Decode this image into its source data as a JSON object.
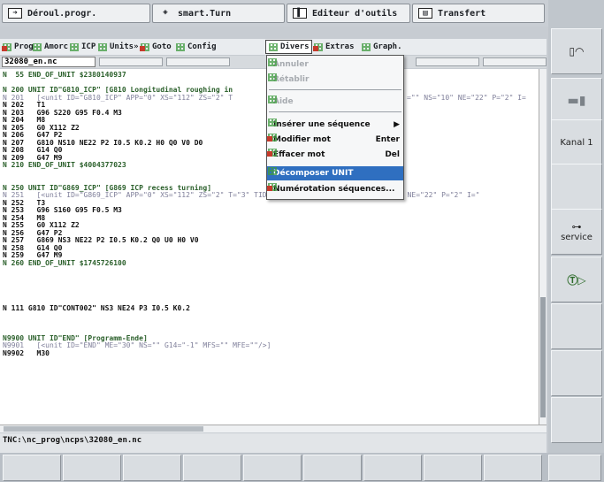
{
  "tabs": [
    {
      "label": "Déroul.progr.",
      "icon": "arrow-right-icon"
    },
    {
      "label": "smart.Turn",
      "icon": "diamond-arrow-icon"
    },
    {
      "label": "Editeur d'outils",
      "icon": "tool-editor-icon"
    },
    {
      "label": "Transfert",
      "icon": "transfer-icon"
    }
  ],
  "menubar": {
    "items": [
      "Prog",
      "Amorc",
      "ICP",
      "Units»",
      "Goto",
      "Config",
      "Divers",
      "Extras",
      "Graph."
    ],
    "active": "Divers"
  },
  "file_tab": "32080_en.nc",
  "dropdown": {
    "items": [
      {
        "label": "Annuler",
        "shortcut": "",
        "disabled": true
      },
      {
        "label": "Rétablir",
        "shortcut": "",
        "disabled": true
      },
      {
        "label": "Aide",
        "shortcut": "",
        "disabled": true
      },
      {
        "label": "Insérer une séquence",
        "shortcut": "",
        "submenu": true
      },
      {
        "label": "Modifier mot",
        "shortcut": "Enter"
      },
      {
        "label": "Effacer mot",
        "shortcut": "Del"
      },
      {
        "label": "Décomposer UNIT",
        "shortcut": "",
        "selected": true
      },
      {
        "label": "Numérotation séquences...",
        "shortcut": ""
      }
    ]
  },
  "code_lines": [
    "N  55 END_OF_UNIT $2380140937",
    "",
    "N 200 UNIT ID\"G810_ICP\" [G810 Longitudinal roughing in",
    "N 201   [<unit ID=\"G810_ICP\" APP=\"0\" XS=\"112\" ZS=\"2\" T",
    "N 202   T1",
    "N 203   G96 S220 G95 F0.4 M3",
    "N 204   M8",
    "N 205   G0 X112 Z2",
    "N 206   G47 P2",
    "N 207   G810 NS10 NE22 P2 I0.5 K0.2 H0 Q0 V0 D0",
    "N 208   G14 Q0",
    "N 209   G47 M9",
    "N 210 END_OF_UNIT $4004377023",
    "",
    "",
    "N 250 UNIT ID\"G869_ICP\" [G869 ICP recess turning]",
    "N 251   [<unit ID=\"G869_ICP\" APP=\"0\" XS=\"112\" ZS=\"2\" T=\"3\" TID=\"\" F=\"0.5\" S=\"160\" FK=\"\" NS=\"3\" NE=\"22\" P=\"2\" I=\"",
    "N 252   T3",
    "N 253   G96 S160 G95 F0.5 M3",
    "N 254   M8",
    "N 255   G0 X112 Z2",
    "N 256   G47 P2",
    "N 257   G869 NS3 NE22 P2 I0.5 K0.2 Q0 U0 H0 V0",
    "N 258   G14 Q0",
    "N 259   G47 M9",
    "N 260 END_OF_UNIT $1745726100",
    "",
    "",
    "",
    "",
    "",
    "N 111 G810 ID\"CONT002\" NS3 NE24 P3 I0.5 K0.2",
    "",
    "",
    "",
    "N9900 UNIT ID\"END\" [Programm-Ende]",
    "N9901   [<unit ID=\"END\" ME=\"30\" NS=\"\" G14=\"-1\" MFS=\"\" MFE=\"\"/>]",
    "N9902   M30"
  ],
  "code_line_201_tail": "=\"\" NS=\"10\" NE=\"22\" P=\"2\" I=",
  "status_path": "TNC:\\nc_prog\\ncps\\32080_en.nc",
  "right_softkeys": [
    "",
    "",
    "Kanal 1",
    "",
    "service",
    "",
    "",
    "",
    ""
  ],
  "colors": {
    "green": "#2a8a3c",
    "selection": "#2f6fc0",
    "background": "#c7ccd2"
  }
}
